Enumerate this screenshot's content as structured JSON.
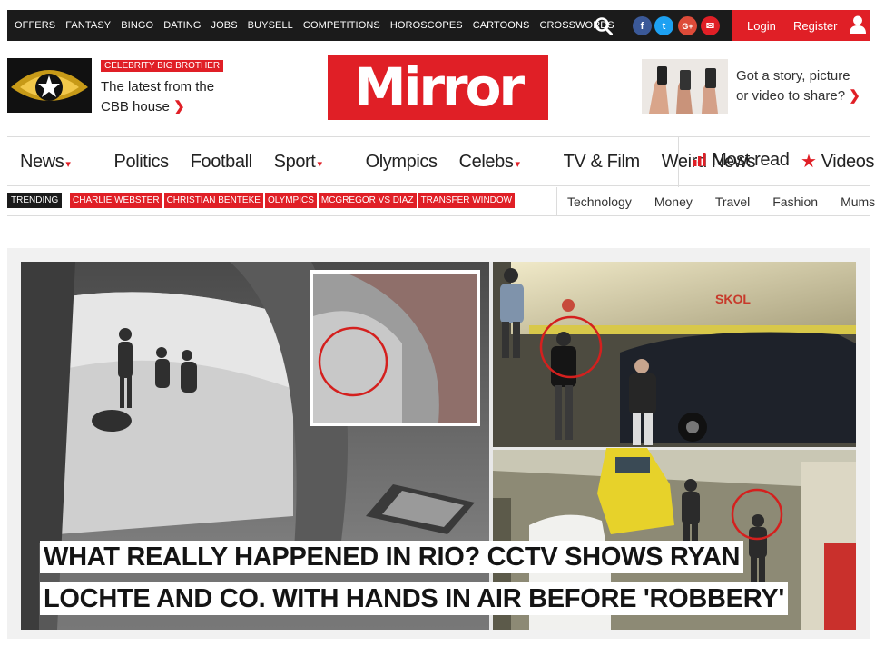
{
  "top_nav": [
    "OFFERS",
    "FANTASY",
    "BINGO",
    "DATING",
    "JOBS",
    "BUYSELL",
    "COMPETITIONS",
    "HOROSCOPES",
    "CARTOONS",
    "CROSSWORDS"
  ],
  "social": {
    "facebook": "f",
    "twitter": "t",
    "googleplus": "G+",
    "email": "✉"
  },
  "auth": {
    "login": "Login",
    "register": "Register"
  },
  "promo": {
    "tag": "CELEBRITY BIG BROTHER",
    "text": "The latest from the CBB house",
    "chevron": "❯"
  },
  "logo": {
    "text": "Mirror",
    "color": "#e01f26"
  },
  "story": {
    "text": "Got a story, picture or video to share?",
    "chevron": "❯"
  },
  "main_nav": [
    {
      "label": "News",
      "caret": "▾"
    },
    {
      "label": "Politics",
      "caret": ""
    },
    {
      "label": "Football",
      "caret": ""
    },
    {
      "label": "Sport",
      "caret": "▾"
    },
    {
      "label": "Olympics",
      "caret": ""
    },
    {
      "label": "Celebs",
      "caret": "▾"
    },
    {
      "label": "TV & Film",
      "caret": ""
    },
    {
      "label": "Weird News",
      "caret": ""
    }
  ],
  "most_read": {
    "icon": "bar-chart-icon",
    "label": "Most read"
  },
  "videos": {
    "icon": "star-icon",
    "label": "Videos"
  },
  "trending": {
    "label": "TRENDING",
    "tags": [
      "CHARLIE WEBSTER",
      "CHRISTIAN BENTEKE",
      "OLYMPICS",
      "MCGREGOR VS DIAZ",
      "TRANSFER WINDOW"
    ]
  },
  "sub_nav": [
    "Technology",
    "Money",
    "Travel",
    "Fashion",
    "Mums"
  ],
  "hero": {
    "headline": "WHAT REALLY HAPPENED IN RIO? CCTV SHOWS RYAN LOCHTE AND CO. WITH HANDS IN AIR BEFORE 'ROBBERY'",
    "sign_text": "SKOL"
  },
  "colors": {
    "brand_red": "#e01f26",
    "topbar": "#1b1b1b"
  }
}
